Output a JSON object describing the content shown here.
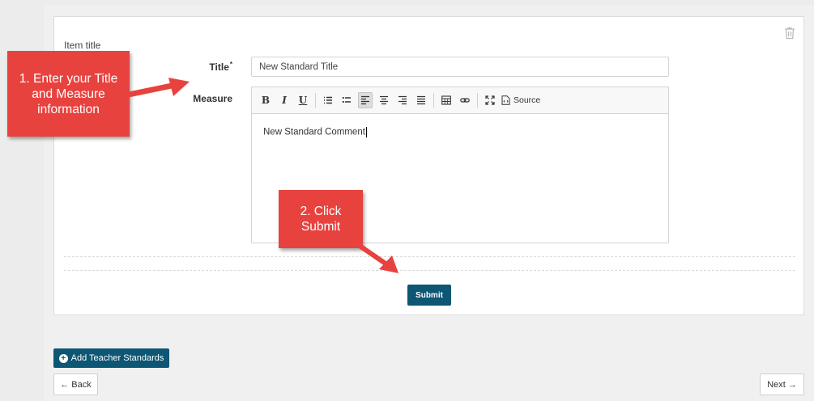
{
  "form": {
    "item_title_label": "Item title",
    "title_label": "Title",
    "required_mark": "*",
    "title_value": "New Standard Title",
    "measure_label": "Measure",
    "measure_content": "New Standard Comment",
    "submit_label": "Submit"
  },
  "toolbar": {
    "bold_label": "B",
    "italic_label": "I",
    "underline_label": "U",
    "source_label": "Source",
    "active_tool": "align-left"
  },
  "footer": {
    "add_label": "Add Teacher Standards",
    "back_label": "Back",
    "next_label": "Next"
  },
  "annotations": {
    "callout1_line1": "1. Enter your Title",
    "callout1_line2": "and Measure",
    "callout1_line3": "information",
    "callout2_line1": "2. Click",
    "callout2_line2": "Submit"
  },
  "colors": {
    "primary": "#0d5674",
    "callout": "#e8423f"
  }
}
